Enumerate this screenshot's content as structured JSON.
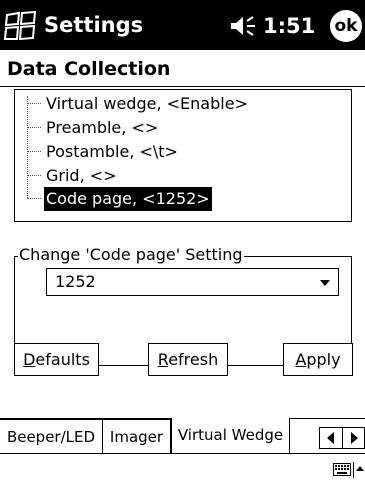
{
  "titlebar": {
    "title": "Settings",
    "time": "1:51",
    "ok_label": "ok"
  },
  "page": {
    "title": "Data Collection"
  },
  "tree": {
    "items": [
      {
        "label": "Virtual wedge, <Enable>",
        "selected": false
      },
      {
        "label": "Preamble, <>",
        "selected": false
      },
      {
        "label": "Postamble, <\\t>",
        "selected": false
      },
      {
        "label": "Grid, <>",
        "selected": false
      },
      {
        "label": "Code page, <1252>",
        "selected": true
      }
    ]
  },
  "setting": {
    "legend": "Change 'Code page' Setting",
    "value": "1252"
  },
  "buttons": {
    "defaults": {
      "pre": "",
      "key": "D",
      "post": "efaults"
    },
    "refresh": {
      "pre": "",
      "key": "R",
      "post": "efresh"
    },
    "apply": {
      "pre": "",
      "key": "A",
      "post": "pply"
    }
  },
  "tabs": [
    {
      "label": "Beeper/LED",
      "active": false
    },
    {
      "label": "Imager",
      "active": false
    },
    {
      "label": "Virtual Wedge",
      "active": true
    }
  ],
  "icons": {
    "start": "windows-start-icon",
    "volume": "speaker-icon",
    "keyboard": "keyboard-icon",
    "sip": "sip-up-arrow-icon",
    "scroll_left": "scroll-left-icon",
    "scroll_right": "scroll-right-icon"
  }
}
